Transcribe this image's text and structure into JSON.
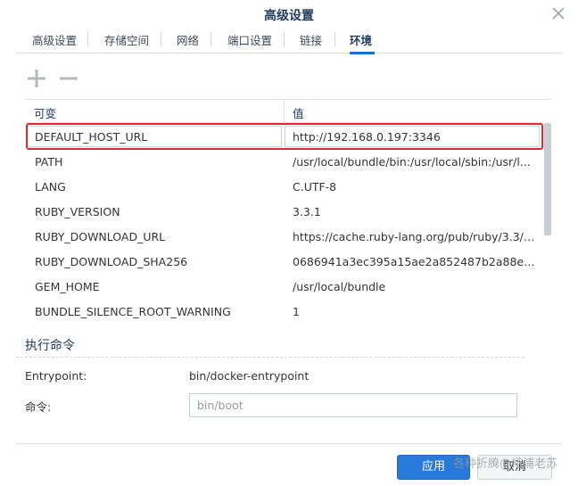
{
  "window": {
    "title": "高级设置"
  },
  "tabs": [
    {
      "label": "高级设置"
    },
    {
      "label": "存储空间"
    },
    {
      "label": "网络"
    },
    {
      "label": "端口设置"
    },
    {
      "label": "链接"
    },
    {
      "label": "环境"
    }
  ],
  "active_tab": "环境",
  "toolbar": {
    "add_icon": "plus-icon",
    "remove_icon": "minus-icon"
  },
  "table": {
    "columns": [
      "可变",
      "值"
    ],
    "rows": [
      {
        "variable": "DEFAULT_HOST_URL",
        "value": "http://192.168.0.197:3346"
      },
      {
        "variable": "PATH",
        "value": "/usr/local/bundle/bin:/usr/local/sbin:/usr/l..."
      },
      {
        "variable": "LANG",
        "value": "C.UTF-8"
      },
      {
        "variable": "RUBY_VERSION",
        "value": "3.3.1"
      },
      {
        "variable": "RUBY_DOWNLOAD_URL",
        "value": "https://cache.ruby-lang.org/pub/ruby/3.3/r..."
      },
      {
        "variable": "RUBY_DOWNLOAD_SHA256",
        "value": "0686941a3ec395a15ae2a852487b2a88e5f..."
      },
      {
        "variable": "GEM_HOME",
        "value": "/usr/local/bundle"
      },
      {
        "variable": "BUNDLE_SILENCE_ROOT_WARNING",
        "value": "1"
      }
    ]
  },
  "exec": {
    "section_title": "执行命令",
    "entrypoint_label": "Entrypoint:",
    "entrypoint_value": "bin/docker-entrypoint",
    "command_label": "命令:",
    "command_value": "bin/boot"
  },
  "buttons": {
    "apply": "应用",
    "cancel": "取消"
  },
  "watermark": "各种折腾@杨浦老苏",
  "colors": {
    "accent": "#2879d8",
    "highlight": "#e0282e",
    "title": "#1f3a5c"
  }
}
